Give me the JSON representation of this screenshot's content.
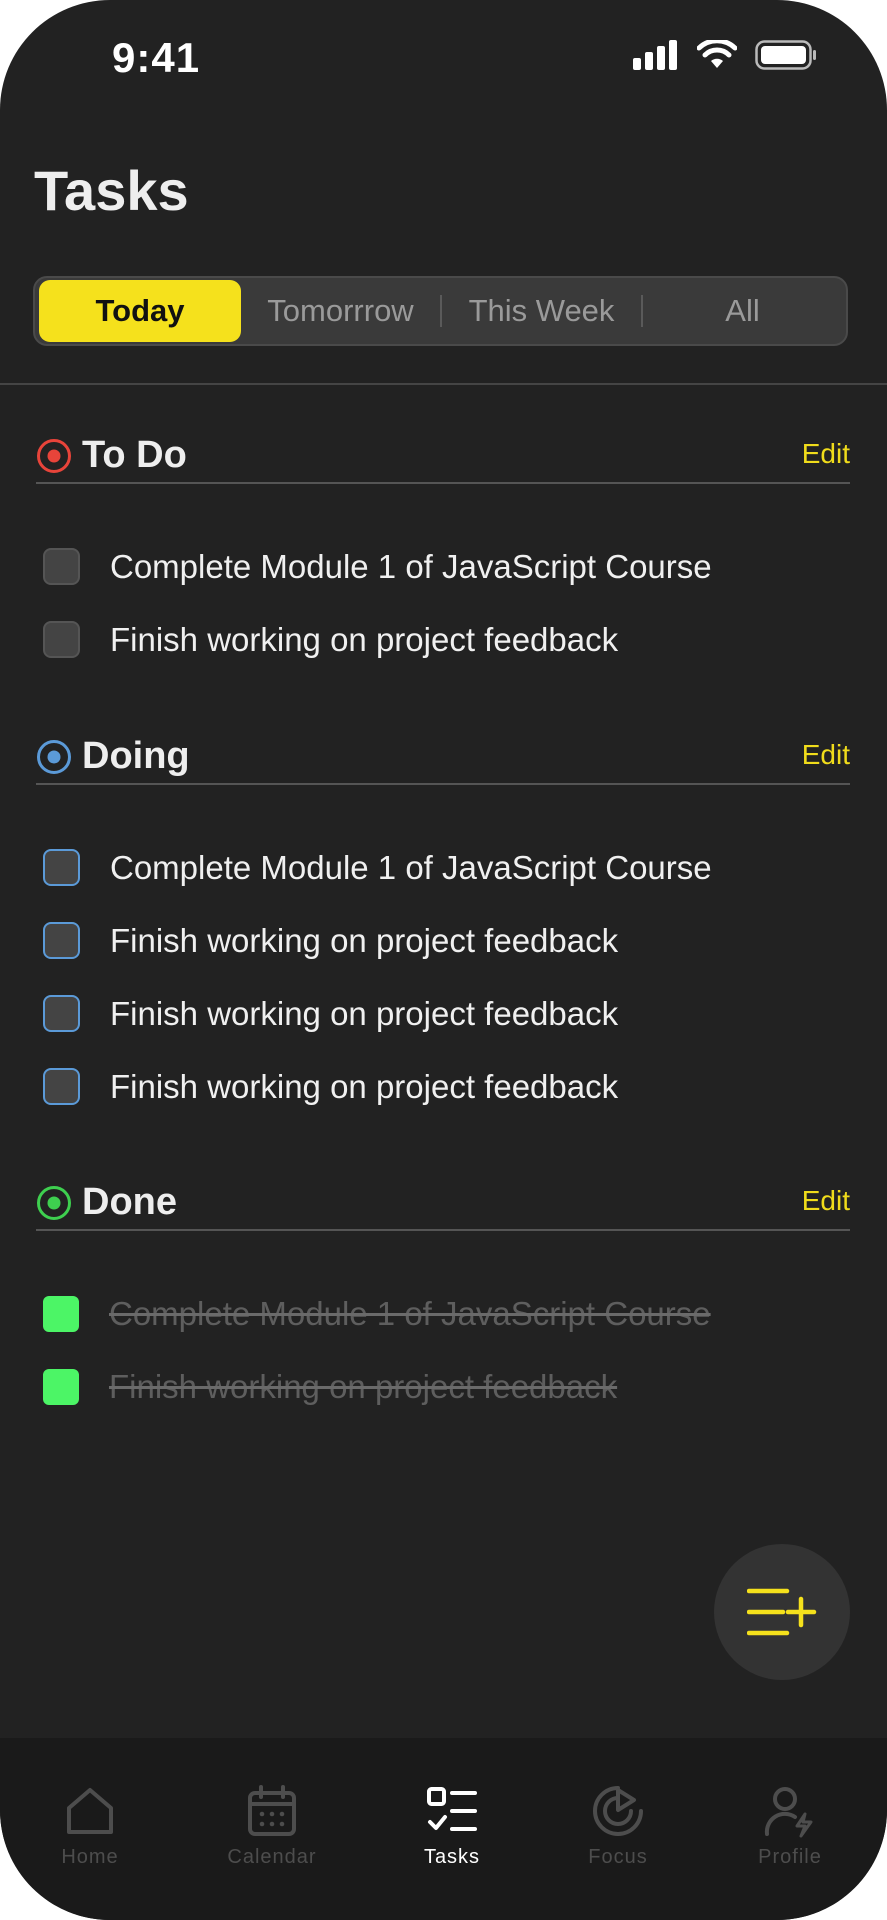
{
  "status_bar": {
    "time": "9:41"
  },
  "page_title": "Tasks",
  "filters": [
    {
      "label": "Today",
      "active": true
    },
    {
      "label": "Tomorrrow",
      "active": false
    },
    {
      "label": "This Week",
      "active": false
    },
    {
      "label": "All",
      "active": false
    }
  ],
  "sections": {
    "todo": {
      "title": "To Do",
      "edit_label": "Edit",
      "color": "#e8443a",
      "tasks": [
        "Complete Module 1 of JavaScript Course",
        "Finish working on project feedback"
      ]
    },
    "doing": {
      "title": "Doing",
      "edit_label": "Edit",
      "color": "#5b9ad8",
      "tasks": [
        "Complete Module 1 of JavaScript Course",
        "Finish working on project feedback",
        "Finish working on project feedback",
        "Finish working on project feedback"
      ]
    },
    "done": {
      "title": "Done",
      "edit_label": "Edit",
      "color": "#3ecf4f",
      "tasks": [
        "Complete Module 1 of JavaScript Course",
        "Finish working on project feedback"
      ]
    }
  },
  "fab": {
    "icon": "add-list-icon",
    "color": "#f5e11c"
  },
  "tabbar": {
    "items": [
      {
        "label": "Home",
        "icon": "home-icon",
        "active": false
      },
      {
        "label": "Calendar",
        "icon": "calendar-icon",
        "active": false
      },
      {
        "label": "Tasks",
        "icon": "tasks-icon",
        "active": true
      },
      {
        "label": "Focus",
        "icon": "focus-icon",
        "active": false
      },
      {
        "label": "Profile",
        "icon": "profile-icon",
        "active": false
      }
    ]
  },
  "colors": {
    "accent": "#f5e11c",
    "background": "#222222",
    "tabbar": "#1a1a1a"
  }
}
